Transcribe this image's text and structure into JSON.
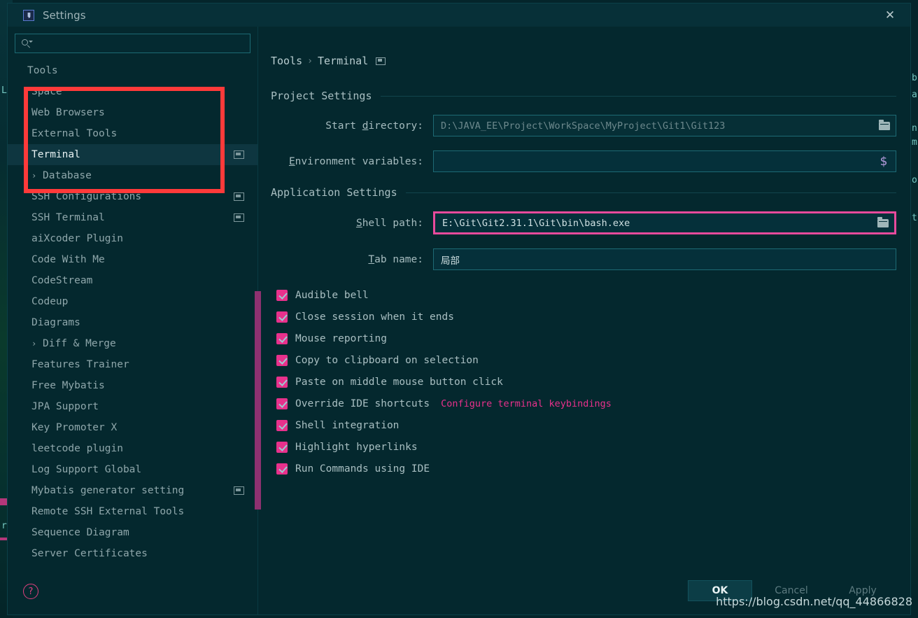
{
  "window": {
    "title": "Settings",
    "app_icon": "intellij-idea-icon",
    "close_label": "✕"
  },
  "sidebar": {
    "search": {
      "placeholder": "",
      "value": "",
      "icon": "search-icon"
    },
    "items": [
      {
        "label": "Tools",
        "level": 0,
        "arrow": "",
        "selected": false,
        "icon": false
      },
      {
        "label": "Space",
        "level": 1,
        "arrow": "",
        "selected": false,
        "icon": false
      },
      {
        "label": "Web Browsers",
        "level": 1,
        "arrow": "",
        "selected": false,
        "icon": false
      },
      {
        "label": "External Tools",
        "level": 1,
        "arrow": "",
        "selected": false,
        "icon": false
      },
      {
        "label": "Terminal",
        "level": 1,
        "arrow": "",
        "selected": true,
        "icon": true
      },
      {
        "label": "Database",
        "level": 1,
        "arrow": "›",
        "selected": false,
        "icon": false
      },
      {
        "label": "SSH Configurations",
        "level": 1,
        "arrow": "",
        "selected": false,
        "icon": true
      },
      {
        "label": "SSH Terminal",
        "level": 1,
        "arrow": "",
        "selected": false,
        "icon": true
      },
      {
        "label": "aiXcoder Plugin",
        "level": 1,
        "arrow": "",
        "selected": false,
        "icon": false
      },
      {
        "label": "Code With Me",
        "level": 1,
        "arrow": "",
        "selected": false,
        "icon": false
      },
      {
        "label": "CodeStream",
        "level": 1,
        "arrow": "",
        "selected": false,
        "icon": false
      },
      {
        "label": "Codeup",
        "level": 1,
        "arrow": "",
        "selected": false,
        "icon": false
      },
      {
        "label": "Diagrams",
        "level": 1,
        "arrow": "",
        "selected": false,
        "icon": false
      },
      {
        "label": "Diff & Merge",
        "level": 1,
        "arrow": "›",
        "selected": false,
        "icon": false
      },
      {
        "label": "Features Trainer",
        "level": 1,
        "arrow": "",
        "selected": false,
        "icon": false
      },
      {
        "label": "Free Mybatis",
        "level": 1,
        "arrow": "",
        "selected": false,
        "icon": false
      },
      {
        "label": "JPA Support",
        "level": 1,
        "arrow": "",
        "selected": false,
        "icon": false
      },
      {
        "label": "Key Promoter X",
        "level": 1,
        "arrow": "",
        "selected": false,
        "icon": false
      },
      {
        "label": "leetcode plugin",
        "level": 1,
        "arrow": "",
        "selected": false,
        "icon": false
      },
      {
        "label": "Log Support Global",
        "level": 1,
        "arrow": "",
        "selected": false,
        "icon": false
      },
      {
        "label": "Mybatis generator setting",
        "level": 1,
        "arrow": "",
        "selected": false,
        "icon": true
      },
      {
        "label": "Remote SSH External Tools",
        "level": 1,
        "arrow": "",
        "selected": false,
        "icon": false
      },
      {
        "label": "Sequence Diagram",
        "level": 1,
        "arrow": "",
        "selected": false,
        "icon": false
      },
      {
        "label": "Server Certificates",
        "level": 1,
        "arrow": "",
        "selected": false,
        "icon": false
      }
    ],
    "help_icon_label": "?"
  },
  "main": {
    "breadcrumb": {
      "root": "Tools",
      "separator": "›",
      "leaf": "Terminal",
      "icon": "project-scope-icon"
    },
    "project_settings": {
      "title": "Project Settings",
      "fields": [
        {
          "label_prefix": "Start ",
          "label_mnemonic": "d",
          "label_suffix": "irectory:",
          "value": "D:\\JAVA_EE\\Project\\WorkSpace\\MyProject\\Git1\\Git123",
          "trailing_icon": "folder-icon",
          "dim": true,
          "highlighted": false
        },
        {
          "label_prefix": "",
          "label_mnemonic": "E",
          "label_suffix": "nvironment variables:",
          "value": "",
          "trailing_icon": "dollar-icon",
          "dim": false,
          "highlighted": false
        }
      ]
    },
    "application_settings": {
      "title": "Application Settings",
      "fields": [
        {
          "label_prefix": "",
          "label_mnemonic": "S",
          "label_suffix": "hell path:",
          "value": "E:\\Git\\Git2.31.1\\Git\\bin\\bash.exe",
          "trailing_icon": "folder-icon",
          "dim": false,
          "highlighted": true
        },
        {
          "label_prefix": "",
          "label_mnemonic": "T",
          "label_suffix": "ab name:",
          "value": "局部",
          "trailing_icon": "",
          "dim": false,
          "highlighted": false,
          "cjk": true
        }
      ],
      "checkboxes": [
        {
          "label": "Audible bell",
          "checked": true,
          "link": ""
        },
        {
          "label": "Close session when it ends",
          "checked": true,
          "link": ""
        },
        {
          "label": "Mouse reporting",
          "checked": true,
          "link": ""
        },
        {
          "label": "Copy to clipboard on selection",
          "checked": true,
          "link": ""
        },
        {
          "label": "Paste on middle mouse button click",
          "checked": true,
          "link": ""
        },
        {
          "label": "Override IDE shortcuts",
          "checked": true,
          "link": "Configure terminal keybindings"
        },
        {
          "label": "Shell integration",
          "checked": true,
          "link": ""
        },
        {
          "label": "Highlight hyperlinks",
          "checked": true,
          "link": ""
        },
        {
          "label": "Run Commands using IDE",
          "checked": true,
          "link": ""
        }
      ]
    }
  },
  "footer": {
    "ok": "OK",
    "cancel": "Cancel",
    "apply": "Apply"
  },
  "watermark": "https://blog.csdn.net/qq_44866828",
  "background_text": {
    "left": [
      "L",
      "r"
    ],
    "right": [
      "b",
      "a",
      "n",
      "m",
      "o",
      "t"
    ]
  },
  "colors": {
    "accent_pink": "#e8318c",
    "scrollbar": "#8e3170",
    "annotation_red": "#ff3a3a",
    "annotation_pink": "#e84a9c",
    "dialog_bg": "#04282e",
    "selected_row": "#0e3640"
  }
}
